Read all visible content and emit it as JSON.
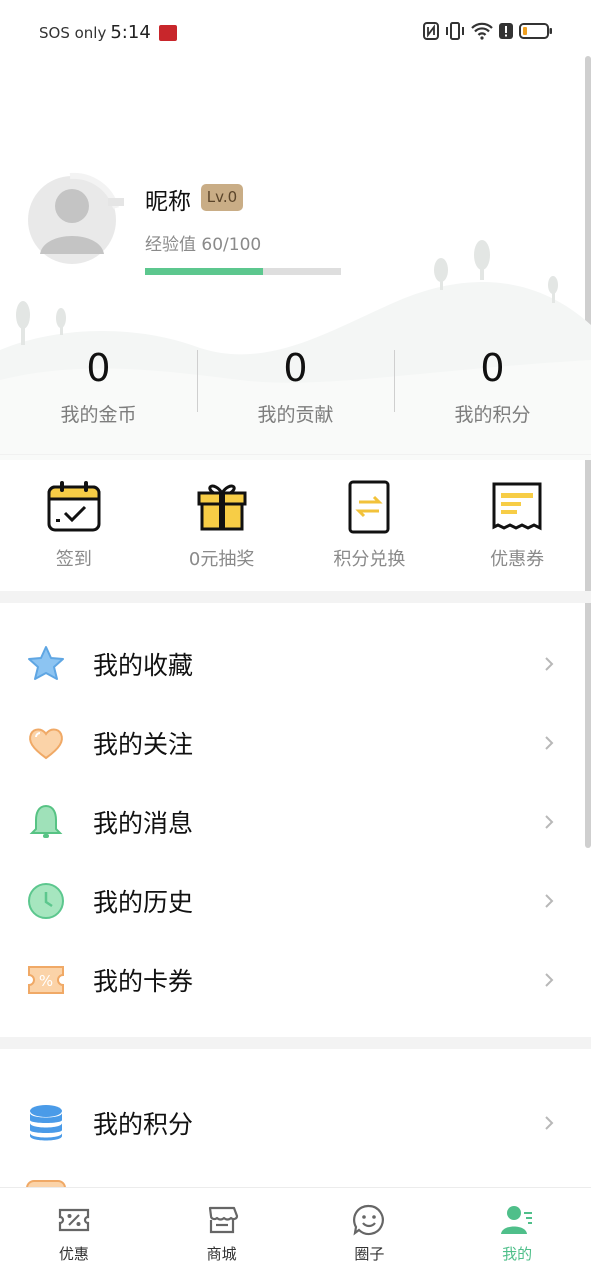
{
  "status_bar": {
    "carrier": "SOS only",
    "time": "5:14"
  },
  "profile": {
    "nickname": "昵称",
    "level": "Lv.0",
    "exp_text": "经验值 60/100",
    "exp_progress": 0.6
  },
  "stats": [
    {
      "value": "0",
      "label": "我的金币"
    },
    {
      "value": "0",
      "label": "我的贡献"
    },
    {
      "value": "0",
      "label": "我的积分"
    }
  ],
  "quick_actions": [
    {
      "label": "签到",
      "icon": "calendar-check-icon"
    },
    {
      "label": "0元抽奖",
      "icon": "gift-icon"
    },
    {
      "label": "积分兑换",
      "icon": "exchange-icon"
    },
    {
      "label": "优惠券",
      "icon": "receipt-icon"
    }
  ],
  "menu": [
    {
      "label": "我的收藏",
      "icon": "star-icon"
    },
    {
      "label": "我的关注",
      "icon": "heart-icon"
    },
    {
      "label": "我的消息",
      "icon": "bell-icon"
    },
    {
      "label": "我的历史",
      "icon": "clock-icon"
    },
    {
      "label": "我的卡券",
      "icon": "coupon-icon"
    }
  ],
  "menu2": [
    {
      "label": "我的积分",
      "icon": "database-icon"
    }
  ],
  "bottom_nav": [
    {
      "label": "优惠",
      "icon": "discount-ticket-icon"
    },
    {
      "label": "商城",
      "icon": "store-icon"
    },
    {
      "label": "圈子",
      "icon": "smile-chat-icon"
    },
    {
      "label": "我的",
      "icon": "profile-icon",
      "active": true
    }
  ],
  "colors": {
    "accent_green": "#4fbf8a",
    "exp_fill": "#5cc78e",
    "badge_gold": "#c9ad86"
  }
}
